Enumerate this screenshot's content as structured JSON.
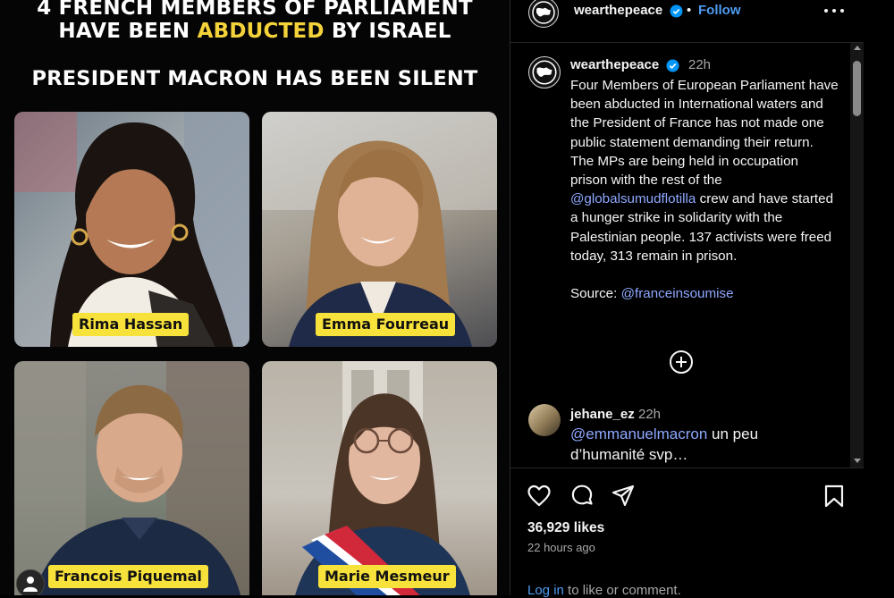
{
  "post_image": {
    "headline_line1": "4 FRENCH MEMBERS OF PARLIAMENT",
    "headline_line2_pre": "HAVE BEEN ",
    "headline_line2_accent": "ABDUCTED",
    "headline_line2_post": " BY ISRAEL",
    "headline_line3": "PRESIDENT MACRON HAS BEEN SILENT",
    "accent_color": "#f4d33a",
    "name_tags": [
      "Rima Hassan",
      "Emma Fourreau",
      "Francois Piquemal",
      "Marie Mesmeur"
    ]
  },
  "header": {
    "username": "wearthepeace",
    "separator": "•",
    "follow_label": "Follow",
    "follow_color": "#4f9bf2"
  },
  "caption": {
    "username": "wearthepeace",
    "time": "22h",
    "text_before_mention": "Four Members of European Parliament have been abducted in International waters and the President of France has not made one public statement demanding their return. The MPs are being held in occupation prison with the rest of the ",
    "mention": "@globalsumudflotilla",
    "text_after_mention": " crew and have started a hunger strike in solidarity with the Palestinian people. 137 activists were freed today, 313 remain in prison.",
    "source_label": "Source: ",
    "source_mention": "@franceinsoumise",
    "mention_color": "#8ea8ff"
  },
  "comment": {
    "username": "jehane_ez",
    "time": "22h",
    "mention": "@emmanuelmacron",
    "text": " un peu d’humanité svp…"
  },
  "footer": {
    "likes": "36,929 likes",
    "time": "22 hours ago",
    "login_link": "Log in",
    "login_rest": " to like or comment."
  },
  "icons": {
    "like": "heart-icon",
    "comment": "comment-bubble-icon",
    "share": "paper-plane-icon",
    "save": "bookmark-icon",
    "more": "more-horizontal-icon",
    "verified": "verified-badge-icon",
    "expand": "plus-circle-icon"
  }
}
